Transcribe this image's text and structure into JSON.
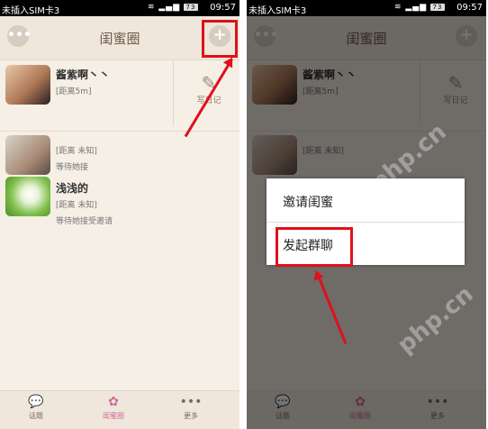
{
  "status_bar": {
    "carrier": "未插入SIM卡3",
    "battery": "73",
    "time": "09:57"
  },
  "header": {
    "title": "闺蜜圈",
    "more_symbol": "•••",
    "add_symbol": "+"
  },
  "friends": [
    {
      "name": "酱紫啊丶丶",
      "distance": "[距离5m]"
    },
    {
      "name": "",
      "distance": "[距离 未知]",
      "status": "等待她接"
    },
    {
      "name": "浅浅的",
      "distance": "[距离 未知]",
      "status": "等待她接受邀请"
    }
  ],
  "diary": {
    "label": "写日记"
  },
  "footer_tabs": [
    {
      "label": "话题"
    },
    {
      "label": "闺蜜圈"
    },
    {
      "label": "更多"
    }
  ],
  "popup": {
    "items": [
      "邀请闺蜜",
      "发起群聊"
    ]
  },
  "watermark": "php.cn",
  "colors": {
    "highlight": "#e0101a",
    "accent_tab": "#d0689a",
    "background": "#f5efe6"
  }
}
